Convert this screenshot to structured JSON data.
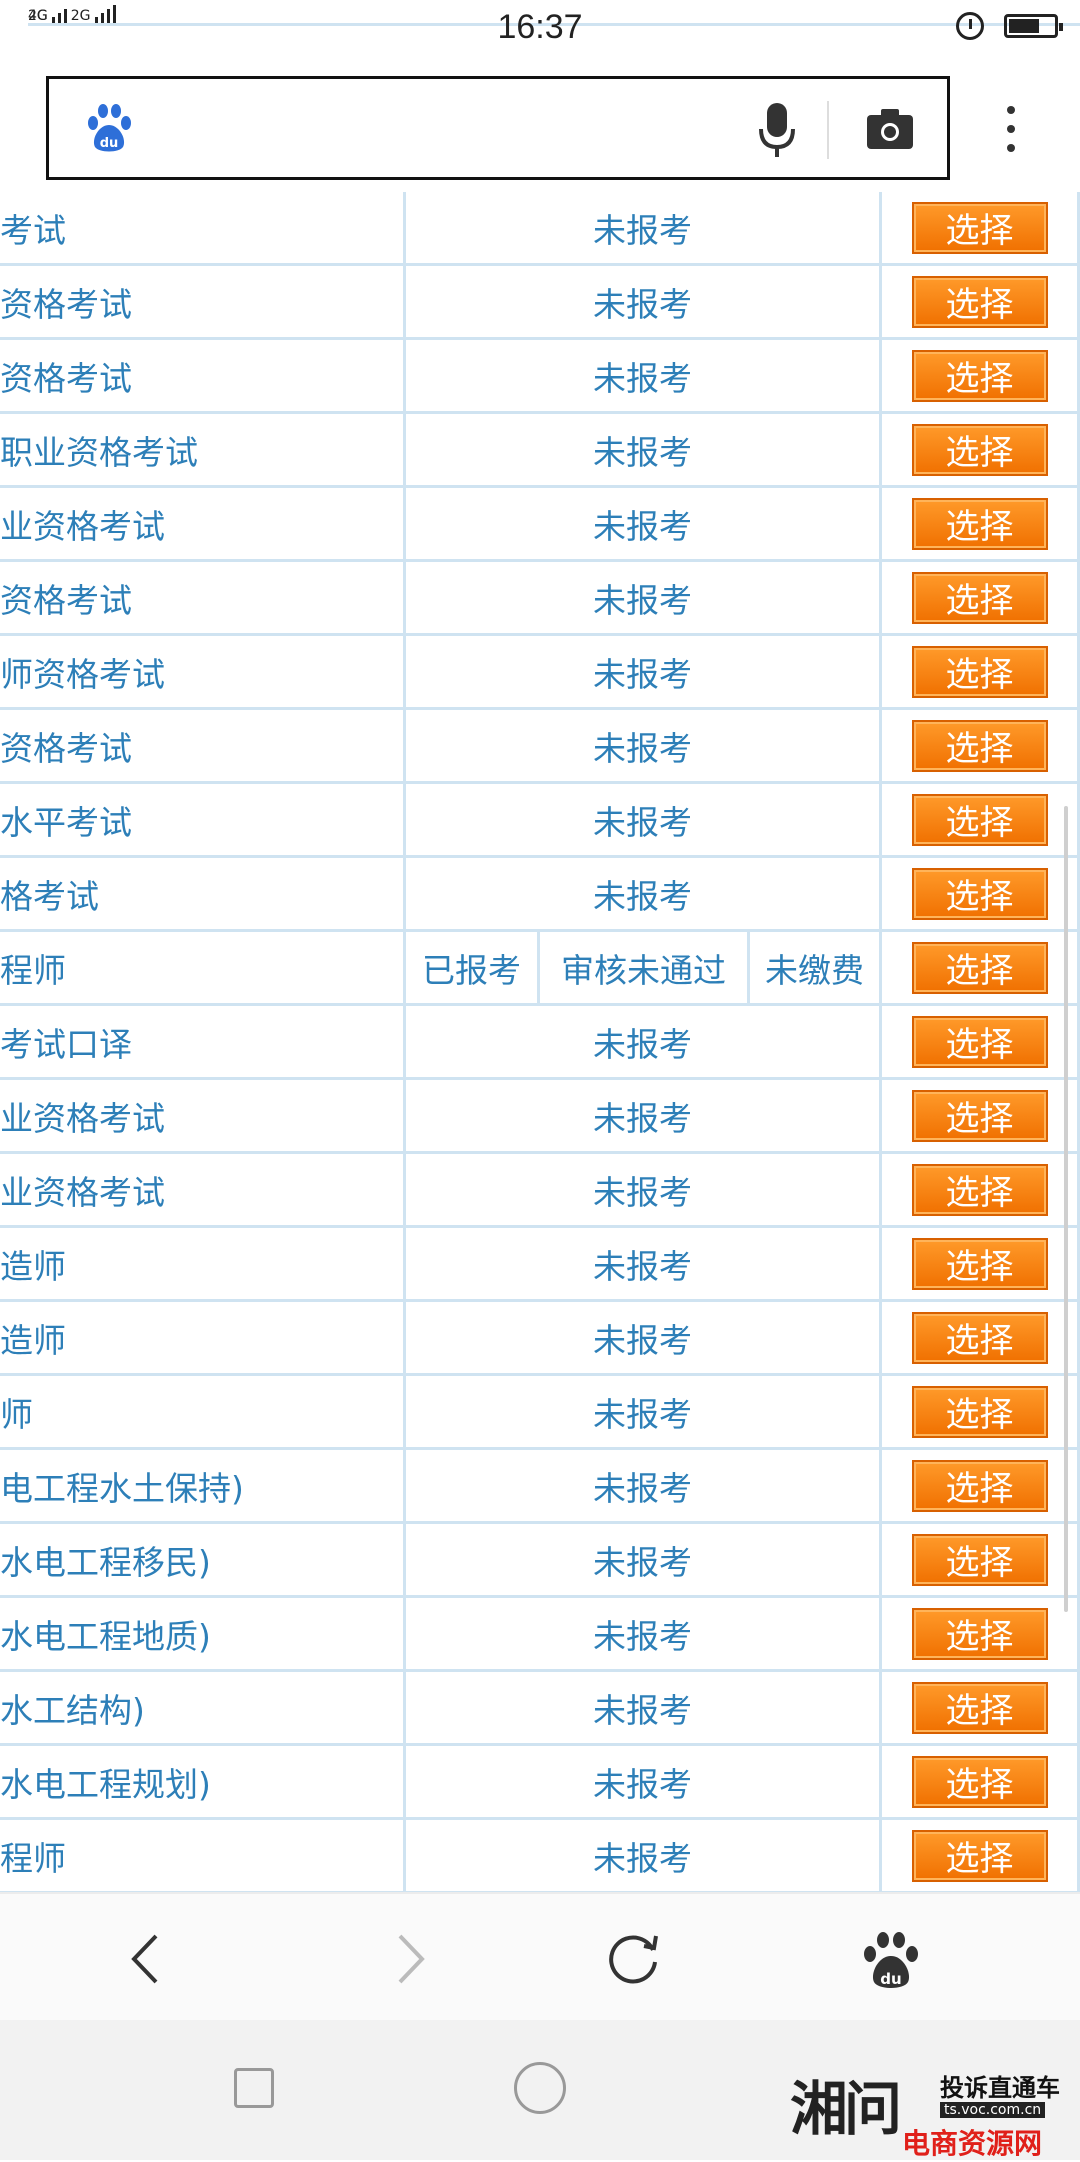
{
  "status_bar": {
    "network_top": "4G",
    "network_bottom": "2G",
    "network_right": "2G",
    "time": "16:37"
  },
  "search": {
    "placeholder": ""
  },
  "table": {
    "rows": [
      {
        "name": "考试",
        "status": "未报考",
        "action": "选择"
      },
      {
        "name": "资格考试",
        "status": "未报考",
        "action": "选择"
      },
      {
        "name": "资格考试",
        "status": "未报考",
        "action": "选择"
      },
      {
        "name": "职业资格考试",
        "status": "未报考",
        "action": "选择"
      },
      {
        "name": "业资格考试",
        "status": "未报考",
        "action": "选择"
      },
      {
        "name": "资格考试",
        "status": "未报考",
        "action": "选择"
      },
      {
        "name": "师资格考试",
        "status": "未报考",
        "action": "选择"
      },
      {
        "name": "资格考试",
        "status": "未报考",
        "action": "选择"
      },
      {
        "name": "水平考试",
        "status": "未报考",
        "action": "选择"
      },
      {
        "name": "格考试",
        "status": "未报考",
        "action": "选择"
      },
      {
        "name": "程师",
        "status_split": [
          "已报考",
          "审核未通过",
          "未缴费"
        ],
        "action": "选择"
      },
      {
        "name": "  考试口译",
        "status": "未报考",
        "action": "选择"
      },
      {
        "name": "业资格考试",
        "status": "未报考",
        "action": "选择"
      },
      {
        "name": "业资格考试",
        "status": "未报考",
        "action": "选择"
      },
      {
        "name": "造师",
        "status": "未报考",
        "action": "选择"
      },
      {
        "name": "造师",
        "status": "未报考",
        "action": "选择"
      },
      {
        "name": "师",
        "status": "未报考",
        "action": "选择"
      },
      {
        "name": "电工程水土保持)",
        "status": "未报考",
        "action": "选择"
      },
      {
        "name": "水电工程移民)",
        "status": "未报考",
        "action": "选择"
      },
      {
        "name": "水电工程地质)",
        "status": "未报考",
        "action": "选择"
      },
      {
        "name": "水工结构)",
        "status": "未报考",
        "action": "选择"
      },
      {
        "name": "水电工程规划)",
        "status": "未报考",
        "action": "选择"
      },
      {
        "name": "程师",
        "status": "未报考",
        "action": "选择"
      }
    ]
  },
  "icons": {
    "search_logo": "baidu-paw-icon",
    "mic": "microphone-icon",
    "camera": "camera-icon",
    "more": "more-vertical-icon",
    "back": "chevron-left-icon",
    "forward": "chevron-right-icon",
    "refresh": "refresh-icon",
    "home": "baidu-paw-icon"
  },
  "watermark": {
    "big": "湘问",
    "small": "投诉直通车",
    "url": "ts.voc.com.cn",
    "red": "电商资源网"
  },
  "colors": {
    "accent_blue": "#2d7fb8",
    "button_orange": "#f58220",
    "grid_line": "#cfe3f1"
  }
}
